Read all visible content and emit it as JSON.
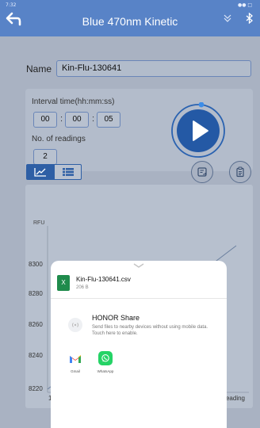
{
  "status": {
    "left": "7:32",
    "right": "●● □"
  },
  "header": {
    "title": "Blue 470nm Kinetic",
    "back_icon": "back-arrow-icon",
    "icons": [
      "chevron-down-icon",
      "bluetooth-icon"
    ]
  },
  "name": {
    "label": "Name",
    "value": "Kin-Flu-130641"
  },
  "interval": {
    "label": "Interval time(hh:mm:ss)",
    "hh": "00",
    "mm": "00",
    "ss": "05"
  },
  "readings": {
    "label": "No. of readings",
    "value": "2"
  },
  "tabs": {
    "chart_icon": "line-chart-icon",
    "list_icon": "list-icon"
  },
  "actions": {
    "export_icon": "export-icon",
    "report_icon": "clipboard-icon"
  },
  "chart_data": {
    "type": "line",
    "ylabel": "RFU",
    "xlabel": "Reading",
    "ytick_labels": [
      "8300",
      "8280",
      "8260",
      "8240",
      "8220"
    ],
    "xtick_labels": [
      "1"
    ],
    "grid": false
  },
  "share": {
    "file_name": "Kin-Flu-130641.csv",
    "file_size": "206 B",
    "honor_title": "HONOR Share",
    "honor_desc": "Send files to nearby devices without using mobile data. Touch here to enable.",
    "apps": [
      {
        "label": "Gmail",
        "icon": "gmail-icon"
      },
      {
        "label": "WhatsApp",
        "icon": "whatsapp-icon"
      }
    ]
  },
  "colors": {
    "header": "#5883c7",
    "accent": "#2e5fa5",
    "whatsapp": "#25d366"
  }
}
